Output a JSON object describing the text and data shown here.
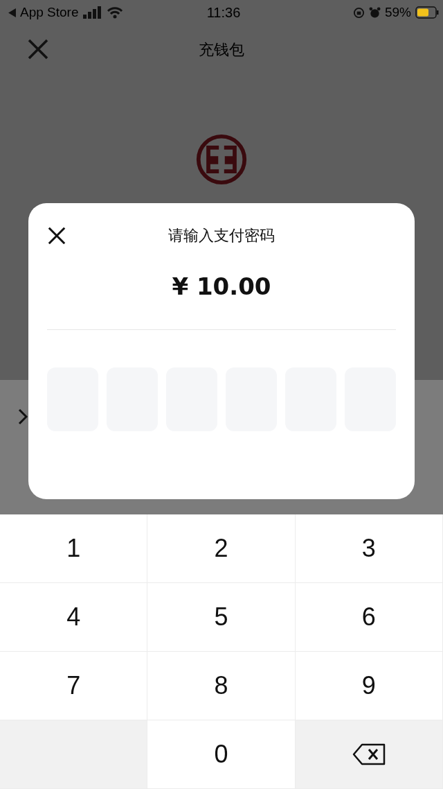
{
  "status_bar": {
    "back_label": "App Store",
    "time": "11:36",
    "battery": "59%"
  },
  "header": {
    "title": "充钱包"
  },
  "dialog": {
    "title": "请输入支付密码",
    "amount": "¥ 10.00",
    "pin_boxes": [
      {
        "filled": false
      },
      {
        "filled": false
      },
      {
        "filled": false
      },
      {
        "filled": false
      },
      {
        "filled": false
      },
      {
        "filled": false
      }
    ]
  },
  "keypad": [
    {
      "kind": "digit",
      "label": "1"
    },
    {
      "kind": "digit",
      "label": "2"
    },
    {
      "kind": "digit",
      "label": "3"
    },
    {
      "kind": "digit",
      "label": "4"
    },
    {
      "kind": "digit",
      "label": "5"
    },
    {
      "kind": "digit",
      "label": "6"
    },
    {
      "kind": "digit",
      "label": "7"
    },
    {
      "kind": "digit",
      "label": "8"
    },
    {
      "kind": "digit",
      "label": "9"
    },
    {
      "kind": "blank"
    },
    {
      "kind": "digit",
      "label": "0"
    },
    {
      "kind": "backspace"
    }
  ]
}
